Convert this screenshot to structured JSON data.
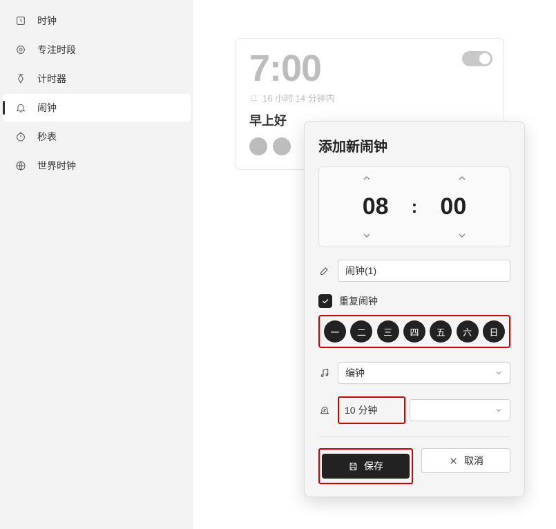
{
  "sidebar": {
    "items": [
      {
        "label": "时钟",
        "icon": "clock-icon"
      },
      {
        "label": "专注时段",
        "icon": "focus-icon"
      },
      {
        "label": "计时器",
        "icon": "timer-icon"
      },
      {
        "label": "闹钟",
        "icon": "alarm-icon"
      },
      {
        "label": "秒表",
        "icon": "stopwatch-icon"
      },
      {
        "label": "世界时钟",
        "icon": "world-clock-icon"
      }
    ],
    "active_index": 3
  },
  "alarm_card": {
    "time": "7:00",
    "time_until": "16 小时 14 分钟内",
    "name": "早上好"
  },
  "dialog": {
    "title": "添加新闹钟",
    "time_hour": "08",
    "time_minute": "00",
    "name_value": "闹钟(1)",
    "repeat_label": "重复闹钟",
    "repeat_checked": true,
    "days": [
      "一",
      "二",
      "三",
      "四",
      "五",
      "六",
      "日"
    ],
    "sound_value": "编钟",
    "snooze_value": "10 分钟",
    "save_label": "保存",
    "cancel_label": "取消"
  }
}
